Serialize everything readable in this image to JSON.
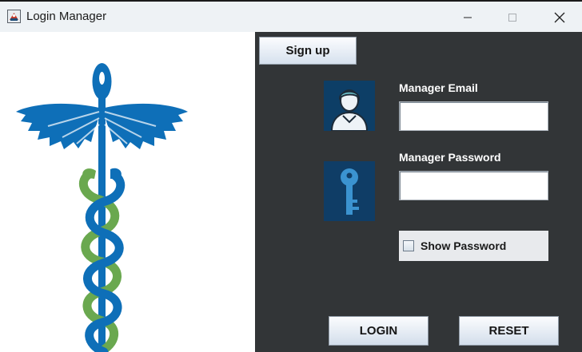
{
  "window": {
    "title": "Login Manager",
    "controls": {
      "minimize": "minimize-icon",
      "maximize": "maximize-icon",
      "close": "close-icon"
    }
  },
  "left_panel": {
    "image": "caduceus-medical-logo"
  },
  "form": {
    "signup_label": "Sign up",
    "email": {
      "icon": "user-icon",
      "label": "Manager Email",
      "value": ""
    },
    "password": {
      "icon": "key-icon",
      "label": "Manager Password",
      "value": ""
    },
    "show_password": {
      "label": "Show Password",
      "checked": false
    },
    "login_label": "LOGIN",
    "reset_label": "RESET"
  },
  "colors": {
    "panel_dark": "#323537",
    "logo_blue": "#0e6fb8",
    "logo_green": "#6aa84f",
    "icon_box": "#0d3e66"
  }
}
